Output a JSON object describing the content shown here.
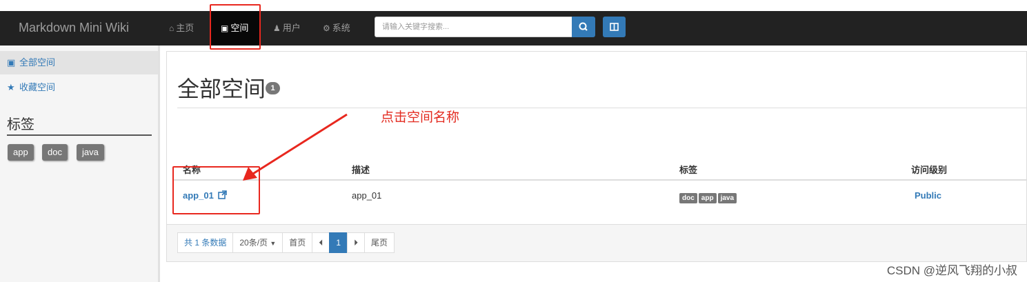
{
  "top_strip": {
    "text": ""
  },
  "navbar": {
    "brand": "Markdown Mini Wiki",
    "items": [
      {
        "icon": "home-icon",
        "label": "主页"
      },
      {
        "icon": "cube-icon",
        "label": "空间",
        "active": true
      },
      {
        "icon": "user-icon",
        "label": "用户"
      },
      {
        "icon": "gear-icon",
        "label": "系统"
      }
    ],
    "search": {
      "placeholder": "请输入关键字搜索...",
      "value": ""
    }
  },
  "sidebar": {
    "items": [
      {
        "icon": "cube-icon",
        "label": "全部空间",
        "active": true
      },
      {
        "icon": "star-icon",
        "label": "收藏空间"
      }
    ],
    "tags_title": "标签",
    "tags": [
      "app",
      "doc",
      "java"
    ]
  },
  "main": {
    "title": "全部空间",
    "count": "1",
    "columns": [
      "名称",
      "描述",
      "标签",
      "访问级别"
    ],
    "rows": [
      {
        "name": "app_01",
        "description": "app_01",
        "tags": [
          "doc",
          "app",
          "java"
        ],
        "access": "Public"
      }
    ],
    "pagination": {
      "total": "共 1 条数据",
      "per_page": "20条/页",
      "first": "首页",
      "current": "1",
      "last": "尾页"
    }
  },
  "annotation": {
    "text": "点击空间名称",
    "color": "#e32b20"
  },
  "watermark": "CSDN @逆风飞翔的小叔",
  "colors": {
    "navbar": "#222222",
    "primary": "#337ab7",
    "tag": "#777777"
  }
}
